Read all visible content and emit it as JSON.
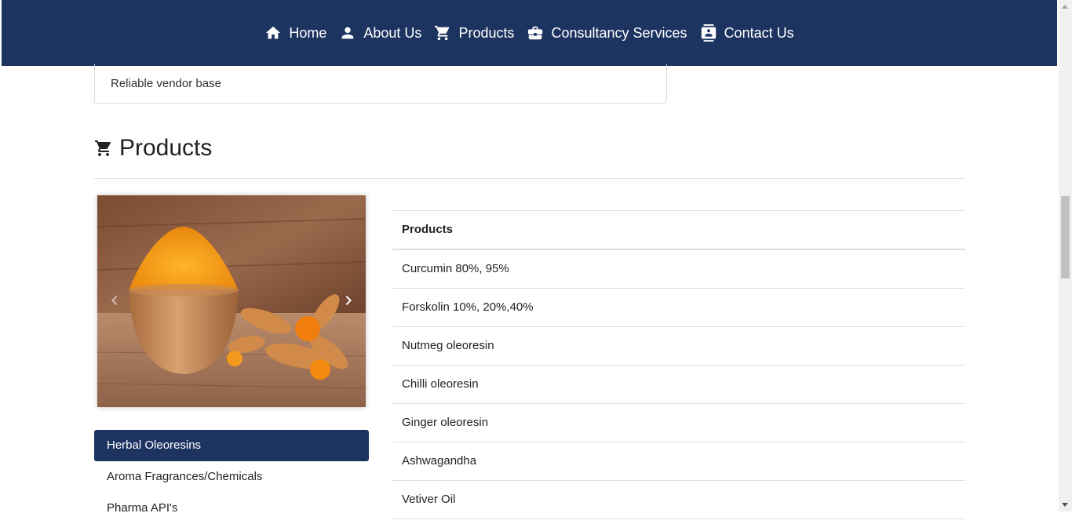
{
  "nav": {
    "items": [
      {
        "label": "Home",
        "icon": "home-icon"
      },
      {
        "label": "About Us",
        "icon": "person-icon"
      },
      {
        "label": "Products",
        "icon": "cart-icon"
      },
      {
        "label": "Consultancy Services",
        "icon": "briefcase-icon"
      },
      {
        "label": "Contact Us",
        "icon": "contact-card-icon"
      }
    ],
    "background": "#1d3461"
  },
  "vendor_card": {
    "text": "Reliable vendor base"
  },
  "products_section": {
    "title": "Products",
    "icon": "cart-icon"
  },
  "carousel": {
    "image_subject": "turmeric powder in wooden bowl with turmeric roots",
    "prev_icon": "chevron-left-icon",
    "next_icon": "chevron-right-icon"
  },
  "categories": [
    {
      "label": "Herbal Oleoresins",
      "active": true
    },
    {
      "label": "Aroma Fragrances/Chemicals",
      "active": false
    },
    {
      "label": "Pharma API's",
      "active": false
    }
  ],
  "table": {
    "header": "Products",
    "rows": [
      "Curcumin 80%, 95%",
      "Forskolin 10%, 20%,40%",
      "Nutmeg oleoresin",
      "Chilli oleoresin",
      "Ginger oleoresin",
      "Ashwagandha",
      "Vetiver Oil"
    ]
  },
  "colors": {
    "primary": "#1d3461",
    "turmeric": "#f39a1e"
  }
}
